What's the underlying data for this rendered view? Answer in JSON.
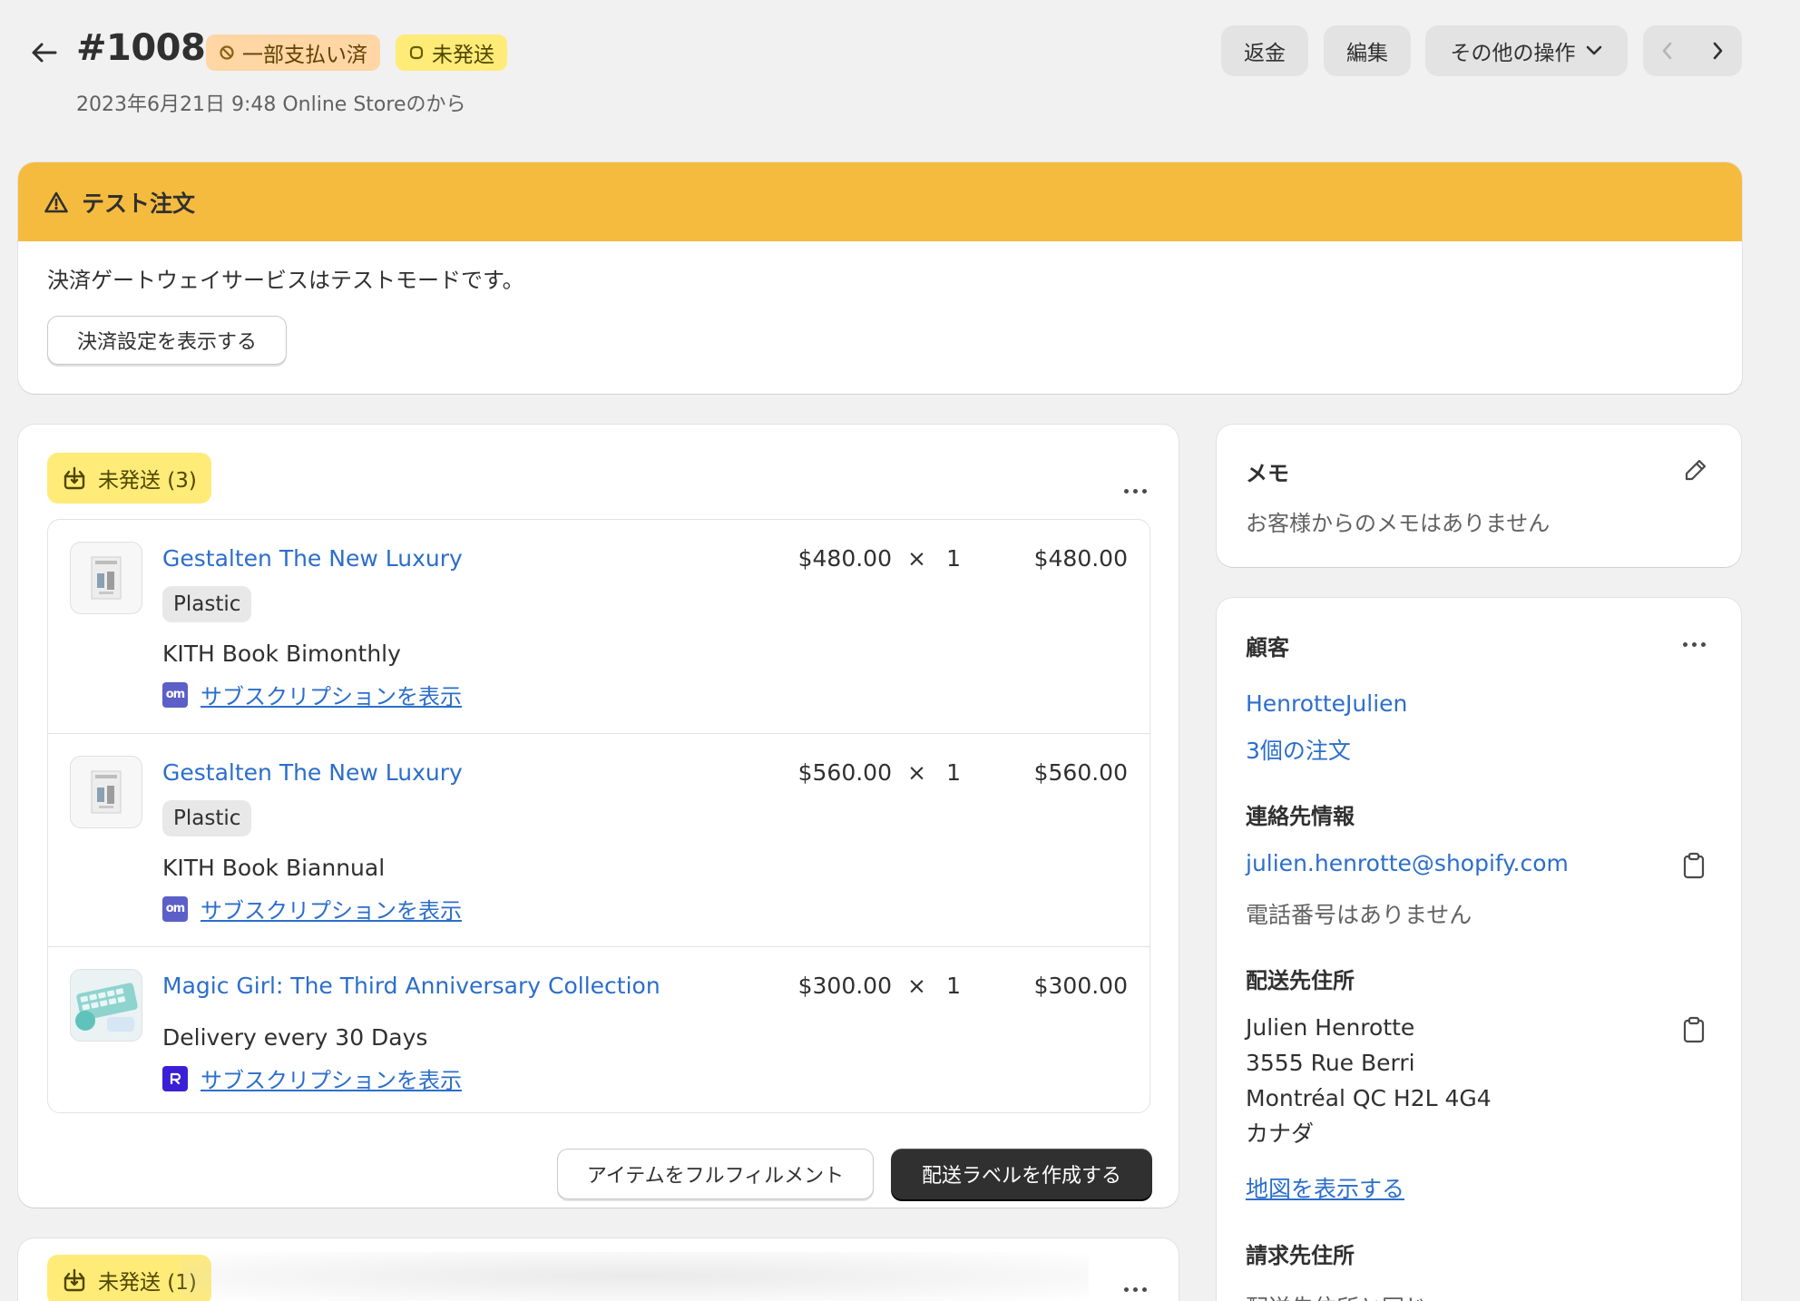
{
  "header": {
    "order_number": "#1008",
    "payment_badge": "一部支払い済",
    "fulfillment_badge": "未発送",
    "meta": "2023年6月21日 9:48 Online Storeのから",
    "actions": {
      "refund": "返金",
      "edit": "編集",
      "more": "その他の操作"
    }
  },
  "banner": {
    "title": "テスト注文",
    "text": "決済ゲートウェイサービスはテストモードです。",
    "button": "決済設定を表示する"
  },
  "fulfillment": {
    "status": "未発送 (3)",
    "items": [
      {
        "title": "Gestalten The New Luxury",
        "variant": "Plastic",
        "plan": "KITH Book Bimonthly",
        "link": "サブスクリプションを表示",
        "unit_price": "$480.00",
        "times": "×",
        "qty": "1",
        "total": "$480.00"
      },
      {
        "title": "Gestalten The New Luxury",
        "variant": "Plastic",
        "plan": "KITH Book Biannual",
        "link": "サブスクリプションを表示",
        "unit_price": "$560.00",
        "times": "×",
        "qty": "1",
        "total": "$560.00"
      },
      {
        "title": "Magic Girl: The Third Anniversary Collection",
        "plan": "Delivery every 30 Days",
        "link": "サブスクリプションを表示",
        "unit_price": "$300.00",
        "times": "×",
        "qty": "1",
        "total": "$300.00"
      }
    ],
    "sub_icon_a": "om",
    "fulfill_button": "アイテムをフルフィルメント",
    "label_button": "配送ラベルを作成する"
  },
  "fulfillment_2": {
    "status": "未発送 (1)"
  },
  "memo": {
    "title": "メモ",
    "text": "お客様からのメモはありません"
  },
  "customer": {
    "title": "顧客",
    "name": "HenrotteJulien",
    "orders": "3個の注文",
    "contact_title": "連絡先情報",
    "email": "julien.henrotte@shopify.com",
    "phone": "電話番号はありません",
    "shipping_title": "配送先住所",
    "address_lines": [
      "Julien Henrotte",
      "3555 Rue Berri",
      "Montréal QC H2L 4G4",
      "カナダ"
    ],
    "map_link": "地図を表示する",
    "billing_title": "請求先住所",
    "billing_text": "配送先住所と同じ"
  },
  "colors": {
    "banner": "#f5bb3e",
    "link": "#2c6ecb",
    "unfulfilled_badge": "#ffeb78",
    "partially_paid_badge": "#ffd6a4"
  }
}
